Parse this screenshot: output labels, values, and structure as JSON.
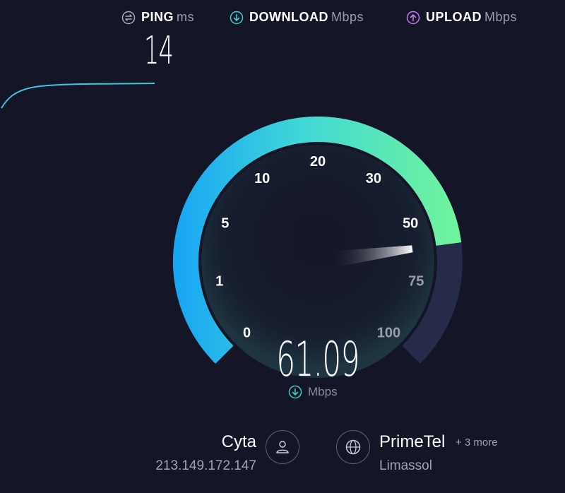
{
  "header": {
    "ping": {
      "label": "PING",
      "unit": "ms",
      "icon": "ping-icon"
    },
    "download": {
      "label": "DOWNLOAD",
      "unit": "Mbps",
      "icon": "download-arrow-icon"
    },
    "upload": {
      "label": "UPLOAD",
      "unit": "Mbps",
      "icon": "upload-arrow-icon"
    }
  },
  "ping_value": "14",
  "gauge": {
    "scale_labels": [
      "0",
      "1",
      "5",
      "10",
      "20",
      "30",
      "50",
      "75",
      "100"
    ],
    "speed": "61.09",
    "speed_numeric": 61.09,
    "unit": "Mbps",
    "colors": {
      "start": "#1aa9f2",
      "end": "#6ef09a",
      "track": "#252b49"
    }
  },
  "isp": {
    "name": "Cyta",
    "ip": "213.149.172.147",
    "icon": "user-icon"
  },
  "server": {
    "name": "PrimeTel",
    "more": "+ 3 more",
    "location": "Limassol",
    "icon": "globe-icon"
  }
}
